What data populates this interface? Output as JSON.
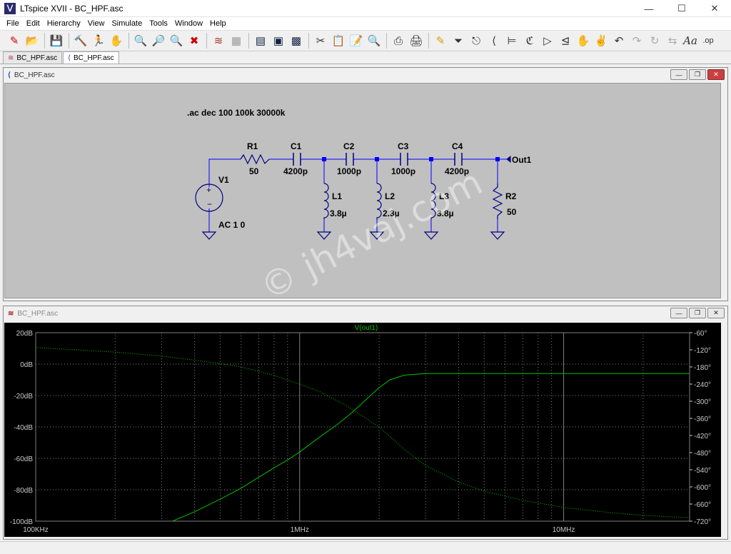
{
  "window": {
    "title": "LTspice XVII - BC_HPF.asc"
  },
  "menu": [
    "File",
    "Edit",
    "Hierarchy",
    "View",
    "Simulate",
    "Tools",
    "Window",
    "Help"
  ],
  "toolbar": [
    "new-schematic",
    "open",
    "save",
    "control-panel",
    "run",
    "halt",
    "zoom-in",
    "zoom-out",
    "zoom-pan",
    "zoom-fit",
    "waveform",
    "autorange",
    "tile",
    "cascade",
    "close-all",
    "cut",
    "copy",
    "paste",
    "find",
    "print-setup",
    "print",
    "draw-wire",
    "ground",
    "label-net",
    "resistor",
    "capacitor",
    "inductor",
    "diode",
    "component",
    "move",
    "drag",
    "undo",
    "redo",
    "rotate",
    "mirror",
    "text",
    "spice-directive"
  ],
  "tabs": [
    {
      "label": "BC_HPF.asc",
      "icon": "waveform-icon"
    },
    {
      "label": "BC_HPF.asc",
      "icon": "schematic-icon"
    }
  ],
  "schematic": {
    "title": "BC_HPF.asc",
    "directive": ".ac dec 100 100k 30000k",
    "labels": {
      "R1": "R1",
      "R1v": "50",
      "C1": "C1",
      "C1v": "4200p",
      "C2": "C2",
      "C2v": "1000p",
      "C3": "C3",
      "C3v": "1000p",
      "C4": "C4",
      "C4v": "4200p",
      "L1": "L1",
      "L1v": "3.8µ",
      "L2": "L2",
      "L2v": "2.3µ",
      "L3": "L3",
      "L3v": "3.8µ",
      "R2": "R2",
      "R2v": "50",
      "V1": "V1",
      "V1v": "AC 1 0",
      "out": "Out1"
    }
  },
  "plot_window": {
    "title": "BC_HPF.asc"
  },
  "chart_data": {
    "type": "line",
    "title": "V(out1)",
    "x_scale": "log",
    "xlim": [
      100000,
      30000000
    ],
    "x_ticks": [
      {
        "value": 100000,
        "label": "100KHz"
      },
      {
        "value": 1000000,
        "label": "1MHz"
      },
      {
        "value": 10000000,
        "label": "10MHz"
      }
    ],
    "ylim": [
      -100,
      20
    ],
    "y_ticks": [
      "20dB",
      "0dB",
      "-20dB",
      "-40dB",
      "-60dB",
      "-80dB",
      "-100dB"
    ],
    "y_tick_values": [
      20,
      0,
      -20,
      -40,
      -60,
      -80,
      -100
    ],
    "y2lim": [
      -720,
      -60
    ],
    "y2_ticks": [
      "-60°",
      "-120°",
      "-180°",
      "-240°",
      "-300°",
      "-360°",
      "-420°",
      "-480°",
      "-540°",
      "-600°",
      "-660°",
      "-720°"
    ],
    "y2_tick_values": [
      -60,
      -120,
      -180,
      -240,
      -300,
      -360,
      -420,
      -480,
      -540,
      -600,
      -660,
      -720
    ],
    "grid": true,
    "series": [
      {
        "name": "V(out1)",
        "axis": "left",
        "style": "solid",
        "x": [
          330000,
          400000,
          500000,
          600000,
          700000,
          800000,
          900000,
          1000000,
          1200000,
          1400000,
          1600000,
          1800000,
          2000000,
          2200000,
          2500000,
          3000000,
          5000000,
          10000000,
          20000000,
          30000000
        ],
        "y": [
          -100,
          -94,
          -86,
          -79,
          -72,
          -66,
          -61,
          -56,
          -46,
          -38,
          -30,
          -22,
          -15,
          -10,
          -7,
          -6,
          -6,
          -6,
          -6,
          -6
        ]
      },
      {
        "name": "phase",
        "axis": "right",
        "style": "dotted",
        "x": [
          100000,
          200000,
          300000,
          400000,
          500000,
          600000,
          700000,
          800000,
          1000000,
          1200000,
          1500000,
          2000000,
          2500000,
          3000000,
          4000000,
          5000000,
          7000000,
          10000000,
          15000000,
          20000000,
          30000000
        ],
        "y": [
          -112,
          -128,
          -142,
          -156,
          -168,
          -180,
          -195,
          -210,
          -240,
          -268,
          -315,
          -390,
          -470,
          -525,
          -583,
          -615,
          -647,
          -672,
          -690,
          -700,
          -708
        ]
      }
    ]
  },
  "colors": {
    "trace": "#00c000",
    "wire": "#0000ff",
    "component": "#000080",
    "plot_bg": "#000000",
    "axis_text": "#c8c8c8",
    "grid": "#808080"
  },
  "watermark": "© jh4vaj.com"
}
